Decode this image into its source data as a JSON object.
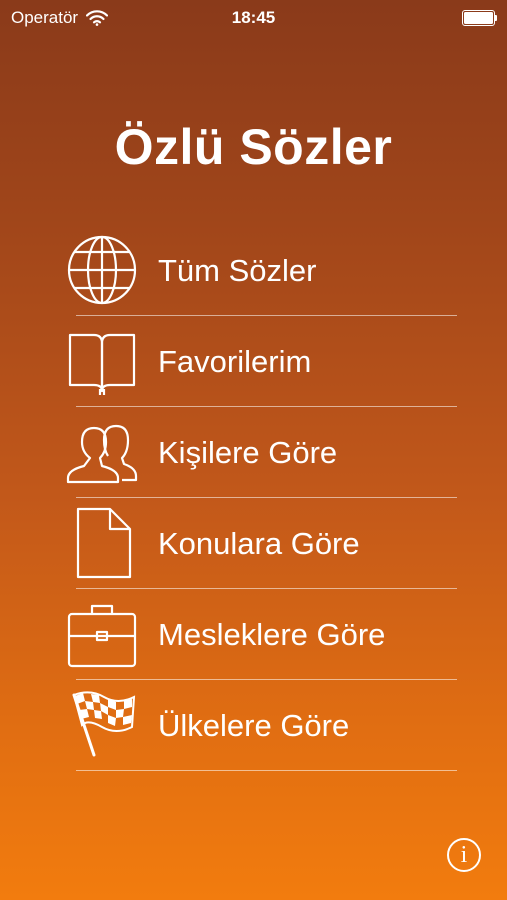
{
  "status_bar": {
    "carrier": "Operatör",
    "time": "18:45",
    "wifi_icon": "wifi-icon",
    "battery_icon": "battery-icon"
  },
  "app_title": "Özlü Sözler",
  "menu": {
    "items": [
      {
        "label": "Tüm Sözler",
        "icon": "globe-icon"
      },
      {
        "label": "Favorilerim",
        "icon": "book-icon"
      },
      {
        "label": "Kişilere Göre",
        "icon": "people-icon"
      },
      {
        "label": "Konulara Göre",
        "icon": "document-icon"
      },
      {
        "label": "Mesleklere Göre",
        "icon": "briefcase-icon"
      },
      {
        "label": "Ülkelere Göre",
        "icon": "checkered-flag-icon"
      }
    ]
  },
  "info_button": {
    "label": "i",
    "icon": "info-icon"
  },
  "colors": {
    "gradient_top": "#8a3a1a",
    "gradient_bottom": "#f27c0e",
    "text": "#ffffff"
  }
}
